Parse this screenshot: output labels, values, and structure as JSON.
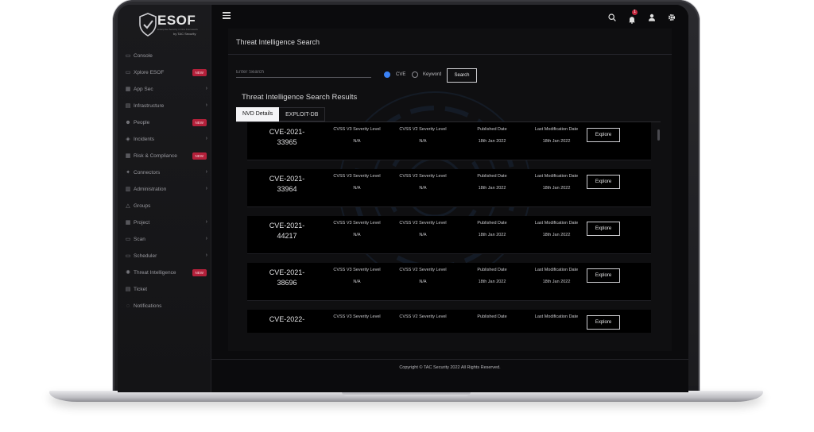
{
  "brand": {
    "name": "ESOF",
    "tagline": "Enterprise Security in One Framework",
    "by": "by TAC Security"
  },
  "sidebar": {
    "items": [
      {
        "label": "Console",
        "icon": "console-icon",
        "chevron": false,
        "badge": ""
      },
      {
        "label": "Xplore ESOF",
        "icon": "explore-icon",
        "chevron": false,
        "badge": "NEW"
      },
      {
        "label": "App Sec",
        "icon": "app-sec-icon",
        "chevron": true,
        "badge": ""
      },
      {
        "label": "Infrastructure",
        "icon": "infrastructure-icon",
        "chevron": true,
        "badge": ""
      },
      {
        "label": "People",
        "icon": "people-icon",
        "chevron": false,
        "badge": "NEW"
      },
      {
        "label": "Incidents",
        "icon": "incidents-icon",
        "chevron": true,
        "badge": ""
      },
      {
        "label": "Risk & Compliance",
        "icon": "risk-icon",
        "chevron": false,
        "badge": "NEW"
      },
      {
        "label": "Connectors",
        "icon": "connectors-icon",
        "chevron": true,
        "badge": ""
      },
      {
        "label": "Administration",
        "icon": "administration-icon",
        "chevron": true,
        "badge": ""
      },
      {
        "label": "Groups",
        "icon": "groups-icon",
        "chevron": false,
        "badge": ""
      },
      {
        "label": "Project",
        "icon": "project-icon",
        "chevron": true,
        "badge": ""
      },
      {
        "label": "Scan",
        "icon": "scan-icon",
        "chevron": true,
        "badge": ""
      },
      {
        "label": "Scheduler",
        "icon": "scheduler-icon",
        "chevron": true,
        "badge": ""
      },
      {
        "label": "Threat Intelligence",
        "icon": "threat-intel-icon",
        "chevron": false,
        "badge": "NEW"
      },
      {
        "label": "Ticket",
        "icon": "ticket-icon",
        "chevron": false,
        "badge": ""
      },
      {
        "label": "Notifications",
        "icon": "notifications-icon",
        "chevron": false,
        "badge": ""
      }
    ]
  },
  "topbar": {
    "notification_count": "1"
  },
  "page": {
    "title": "Threat Intelligence Search",
    "search_placeholder": "Enter Search",
    "radio_cve": "CVE",
    "radio_keyword": "Keyword",
    "search_button": "Search",
    "results_title": "Threat Intelligence Search Results",
    "tabs": [
      "NVD Details",
      "EXPLOIT-DB"
    ]
  },
  "results": {
    "headers": {
      "v3": "CVSS V3 Severity Level",
      "v2": "CVSS V2 Severity Level",
      "published": "Published Date",
      "modified": "Last Modification Date"
    },
    "explore_label": "Explore",
    "rows": [
      {
        "cve_line1": "CVE-2021-",
        "cve_line2": "33965",
        "v3": "N/A",
        "v2": "N/A",
        "published": "18th Jan 2022",
        "modified": "18th Jan 2022"
      },
      {
        "cve_line1": "CVE-2021-",
        "cve_line2": "33964",
        "v3": "N/A",
        "v2": "N/A",
        "published": "18th Jan 2022",
        "modified": "18th Jan 2022"
      },
      {
        "cve_line1": "CVE-2021-",
        "cve_line2": "44217",
        "v3": "N/A",
        "v2": "N/A",
        "published": "18th Jan 2022",
        "modified": "18th Jan 2022"
      },
      {
        "cve_line1": "CVE-2021-",
        "cve_line2": "38696",
        "v3": "N/A",
        "v2": "N/A",
        "published": "18th Jan 2022",
        "modified": "18th Jan 2022"
      },
      {
        "cve_line1": "CVE-2022-",
        "cve_line2": "",
        "v3": "",
        "v2": "",
        "published": "",
        "modified": ""
      }
    ]
  },
  "footer": {
    "copyright": "Copyright © TAC Security 2022 All Rights Reserved."
  },
  "colors": {
    "accent": "#3b82f6",
    "badge": "#b3203a",
    "background": "#0b0b0d"
  }
}
